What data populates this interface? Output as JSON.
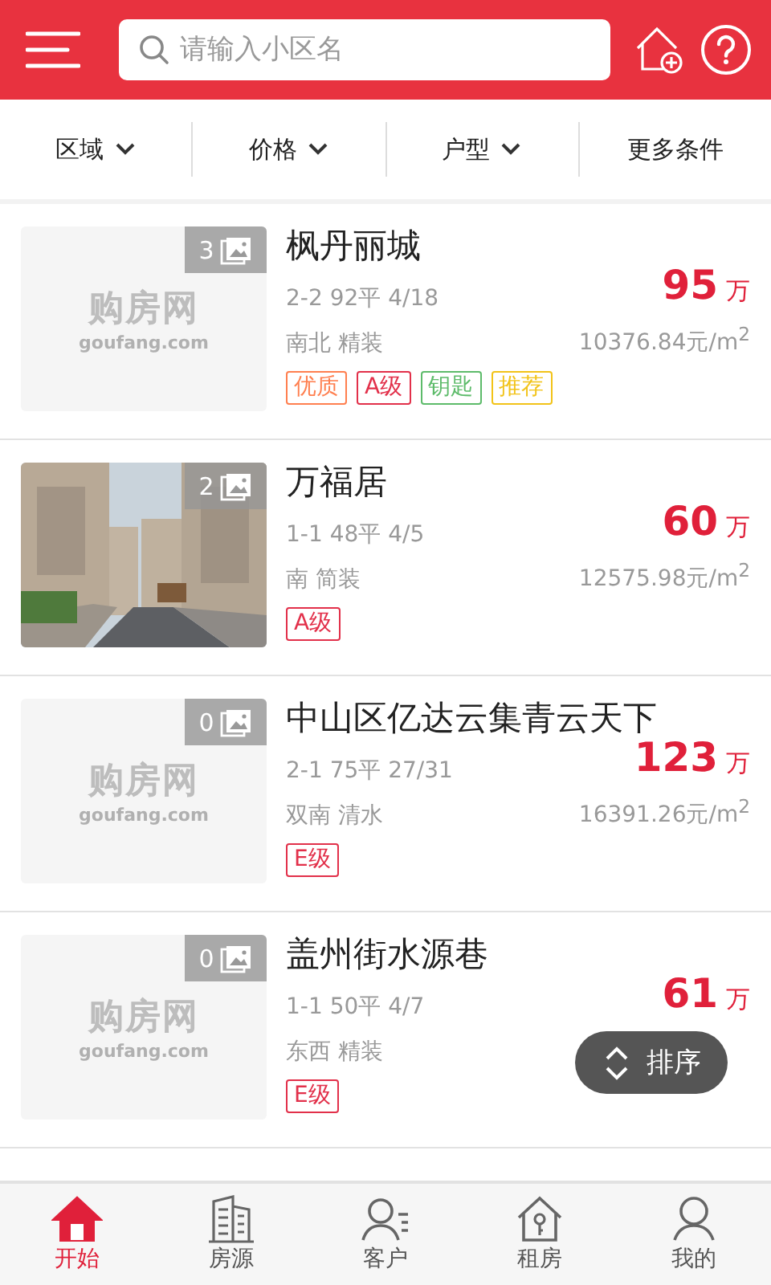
{
  "search": {
    "placeholder": "请输入小区名"
  },
  "filters": [
    {
      "label": "区域",
      "dropdown": true
    },
    {
      "label": "价格",
      "dropdown": true
    },
    {
      "label": "户型",
      "dropdown": true
    },
    {
      "label": "更多条件",
      "dropdown": false
    }
  ],
  "listings": [
    {
      "image": {
        "kind": "placeholder",
        "logo": "购房网",
        "site": "goufang.com"
      },
      "photo_count": "3",
      "title": "枫丹丽城",
      "layout": "2-2 92平 4/18",
      "orientation": "南北 精装",
      "price": "95",
      "price_unit": "万",
      "unit_price": "10376.84元/m$^{2}$",
      "tags": [
        {
          "label": "优质",
          "color": "#ff7f4f"
        },
        {
          "label": "A级",
          "color": "#e2304a"
        },
        {
          "label": "钥匙",
          "color": "#5dbb6a"
        },
        {
          "label": "推荐",
          "color": "#f2c318"
        }
      ]
    },
    {
      "photo_count": "2",
      "title": "万福居",
      "layout": "1-1 48平 4/5",
      "orientation": "南 简装",
      "price": "60",
      "price_unit": "万",
      "unit_price": "12575.98元/m$^{2}$",
      "tags": [
        {
          "label": "A级",
          "color": "#e2304a"
        }
      ]
    },
    {
      "image": {
        "kind": "placeholder",
        "logo": "购房网",
        "site": "goufang.com"
      },
      "photo_count": "0",
      "title": "中山区亿达云集青云天下",
      "layout": "2-1 75平 27/31",
      "orientation": "双南 清水",
      "price": "123",
      "price_unit": "万",
      "unit_price": "16391.26元/m$^{2}$",
      "tags": [
        {
          "label": "E级",
          "color": "#e2304a"
        }
      ]
    },
    {
      "image": {
        "kind": "placeholder",
        "logo": "购房网",
        "site": "goufang.com"
      },
      "photo_count": "0",
      "title": "盖州街水源巷",
      "layout": "1-1 50平 4/7",
      "orientation": "东西 精装",
      "price": "61",
      "price_unit": "万",
      "tags": [
        {
          "label": "E级",
          "color": "#e2304a"
        }
      ]
    }
  ],
  "sort_button": {
    "label": "排序"
  },
  "tabs": [
    {
      "label": "开始",
      "selected": true
    },
    {
      "label": "房源",
      "selected": false
    },
    {
      "label": "客户",
      "selected": false
    },
    {
      "label": "租房",
      "selected": false
    },
    {
      "label": "我的",
      "selected": false
    }
  ]
}
